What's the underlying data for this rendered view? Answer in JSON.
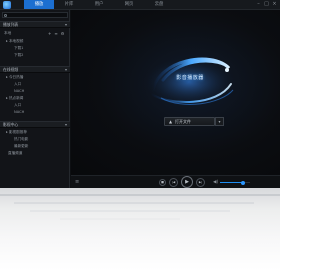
{
  "topbar": {
    "tabs": [
      {
        "label": "播放",
        "active": true
      },
      {
        "label": "片库",
        "active": false
      },
      {
        "label": "用户",
        "active": false
      },
      {
        "label": "网页",
        "active": false
      },
      {
        "label": "云盘",
        "active": false
      }
    ],
    "window_controls": [
      "–",
      "□",
      "×"
    ]
  },
  "sidebar": {
    "search_placeholder": "",
    "sections": [
      {
        "title": "播放列表",
        "rows": [
          {
            "label": "本地",
            "kind": "group"
          },
          {
            "label": "本地视频",
            "kind": "item"
          },
          {
            "label": "下载1",
            "kind": "sub"
          },
          {
            "label": "下载2",
            "kind": "sub"
          }
        ],
        "tools": [
          "+",
          "≡",
          "⚙"
        ]
      },
      {
        "title": "在线视频",
        "rows": [
          {
            "label": "今日热播",
            "kind": "item"
          },
          {
            "label": "入口",
            "kind": "sub"
          },
          {
            "label": "NACH",
            "kind": "sub"
          },
          {
            "label": "热点新闻",
            "kind": "item"
          },
          {
            "label": "入口",
            "kind": "sub"
          },
          {
            "label": "NACH",
            "kind": "sub"
          }
        ]
      },
      {
        "title": "影视中心",
        "rows": [
          {
            "label": "影视剧推荐",
            "kind": "item"
          },
          {
            "label": "热门电影",
            "kind": "sub"
          },
          {
            "label": "最新更新",
            "kind": "sub"
          },
          {
            "label": "直播频道",
            "kind": "sub"
          }
        ]
      }
    ]
  },
  "stage": {
    "brand_text": "影音播放器",
    "open_button_label": "打开文件",
    "open_icon": "▲",
    "dropdown_icon": "▾"
  },
  "controls": {
    "playlist_icon": "≡",
    "stop_icon": "■",
    "prev_icon": "|◀",
    "play_icon": "▶",
    "next_icon": "▶|",
    "volume_icon": "◀)",
    "volume_level": 0.75
  },
  "colors": {
    "accent": "#1c6fd1",
    "background": "#0d0f12",
    "sidebar": "#121418",
    "brand_glow": "#3fa2ff"
  }
}
